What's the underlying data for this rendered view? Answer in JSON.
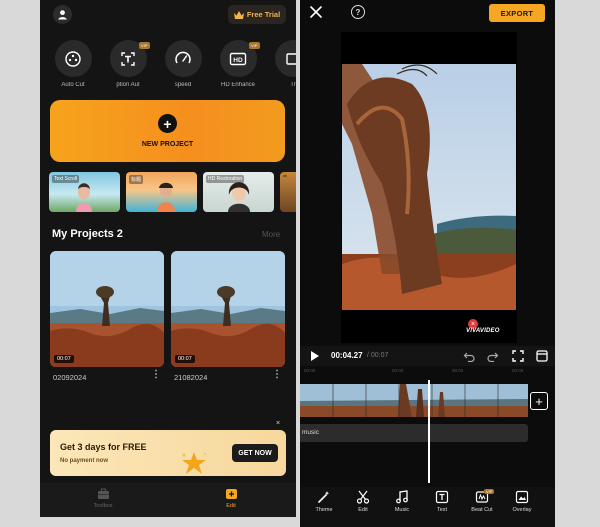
{
  "left_app": {
    "free_trial_label": "Free Trial",
    "tools": [
      {
        "label": "Auto Cut",
        "icon": "auto-cut-icon",
        "vip": false
      },
      {
        "label": "ption  AuI",
        "icon": "caption-icon",
        "vip": true
      },
      {
        "label": "speed",
        "icon": "speed-icon",
        "vip": false
      },
      {
        "label": "HD Enhance",
        "icon": "hd-icon",
        "vip": true
      },
      {
        "label": "Tr",
        "icon": "transition-icon",
        "vip": false
      }
    ],
    "vip_badge": "VIP",
    "new_project_label": "NEW PROJECT",
    "templates": [
      {
        "tag": "Text Scroll"
      },
      {
        "tag": "标题"
      },
      {
        "tag": "HD Restoration"
      },
      {
        "tag": ""
      }
    ],
    "projects_title": "My Projects 2",
    "more_label": "More",
    "projects": [
      {
        "name": "02092024",
        "duration": "00:07"
      },
      {
        "name": "21082024",
        "duration": "00:07"
      }
    ],
    "promo": {
      "title": "Get 3 days for FREE",
      "subtitle": "No payment now",
      "button": "GET NOW",
      "close": "×"
    },
    "tabs": [
      {
        "label": "Toolbox",
        "active": false
      },
      {
        "label": "Edit",
        "active": true
      }
    ],
    "accent_color": "#f5a623"
  },
  "editor": {
    "export_label": "EXPORT",
    "help_label": "?",
    "watermark": "VIVAVIDEO",
    "current_time": "00:04.27",
    "total_time": "/ 00:07",
    "ruler_ticks": [
      "00:00",
      "00:02",
      "00:04",
      "00:06"
    ],
    "add_clip_label": "+",
    "music_track_label": "music",
    "toolbar": [
      {
        "label": "Theme",
        "icon": "magic-wand-icon"
      },
      {
        "label": "Edit",
        "icon": "scissors-icon"
      },
      {
        "label": "Music",
        "icon": "music-note-icon"
      },
      {
        "label": "Text",
        "icon": "text-icon"
      },
      {
        "label": "Beat Cut",
        "icon": "beat-cut-icon",
        "vip": true
      },
      {
        "label": "Overlay",
        "icon": "overlay-icon"
      }
    ]
  }
}
